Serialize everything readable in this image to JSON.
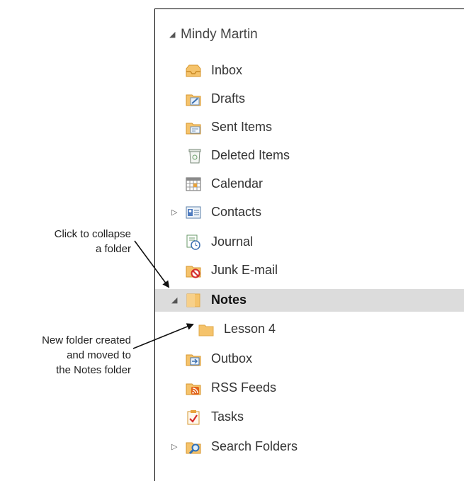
{
  "account": {
    "name": "Mindy Martin",
    "expander": "◢"
  },
  "folders": [
    {
      "label": "Inbox",
      "icon": "inbox-icon"
    },
    {
      "label": "Drafts",
      "icon": "drafts-icon"
    },
    {
      "label": "Sent Items",
      "icon": "sent-items-icon"
    },
    {
      "label": "Deleted Items",
      "icon": "deleted-items-icon"
    },
    {
      "label": "Calendar",
      "icon": "calendar-icon"
    },
    {
      "label": "Contacts",
      "icon": "contacts-icon",
      "expander": "▷"
    },
    {
      "label": "Journal",
      "icon": "journal-icon"
    },
    {
      "label": "Junk E-mail",
      "icon": "junk-email-icon"
    },
    {
      "label": "Notes",
      "icon": "notes-icon",
      "expander": "◢",
      "selected": true
    },
    {
      "label": "Lesson 4",
      "icon": "folder-icon"
    },
    {
      "label": "Outbox",
      "icon": "outbox-icon"
    },
    {
      "label": "RSS Feeds",
      "icon": "rss-feeds-icon"
    },
    {
      "label": "Tasks",
      "icon": "tasks-icon"
    },
    {
      "label": "Search Folders",
      "icon": "search-folders-icon",
      "expander": "▷"
    }
  ],
  "annotations": {
    "collapse": [
      "Click to collapse",
      "a folder"
    ],
    "new_folder": [
      "New folder created",
      "and moved to",
      "the Notes folder"
    ]
  },
  "colors": {
    "selected_row": "#dcdcdc",
    "folder_yellow": "#f5c36b",
    "folder_orange": "#e8a33d"
  }
}
